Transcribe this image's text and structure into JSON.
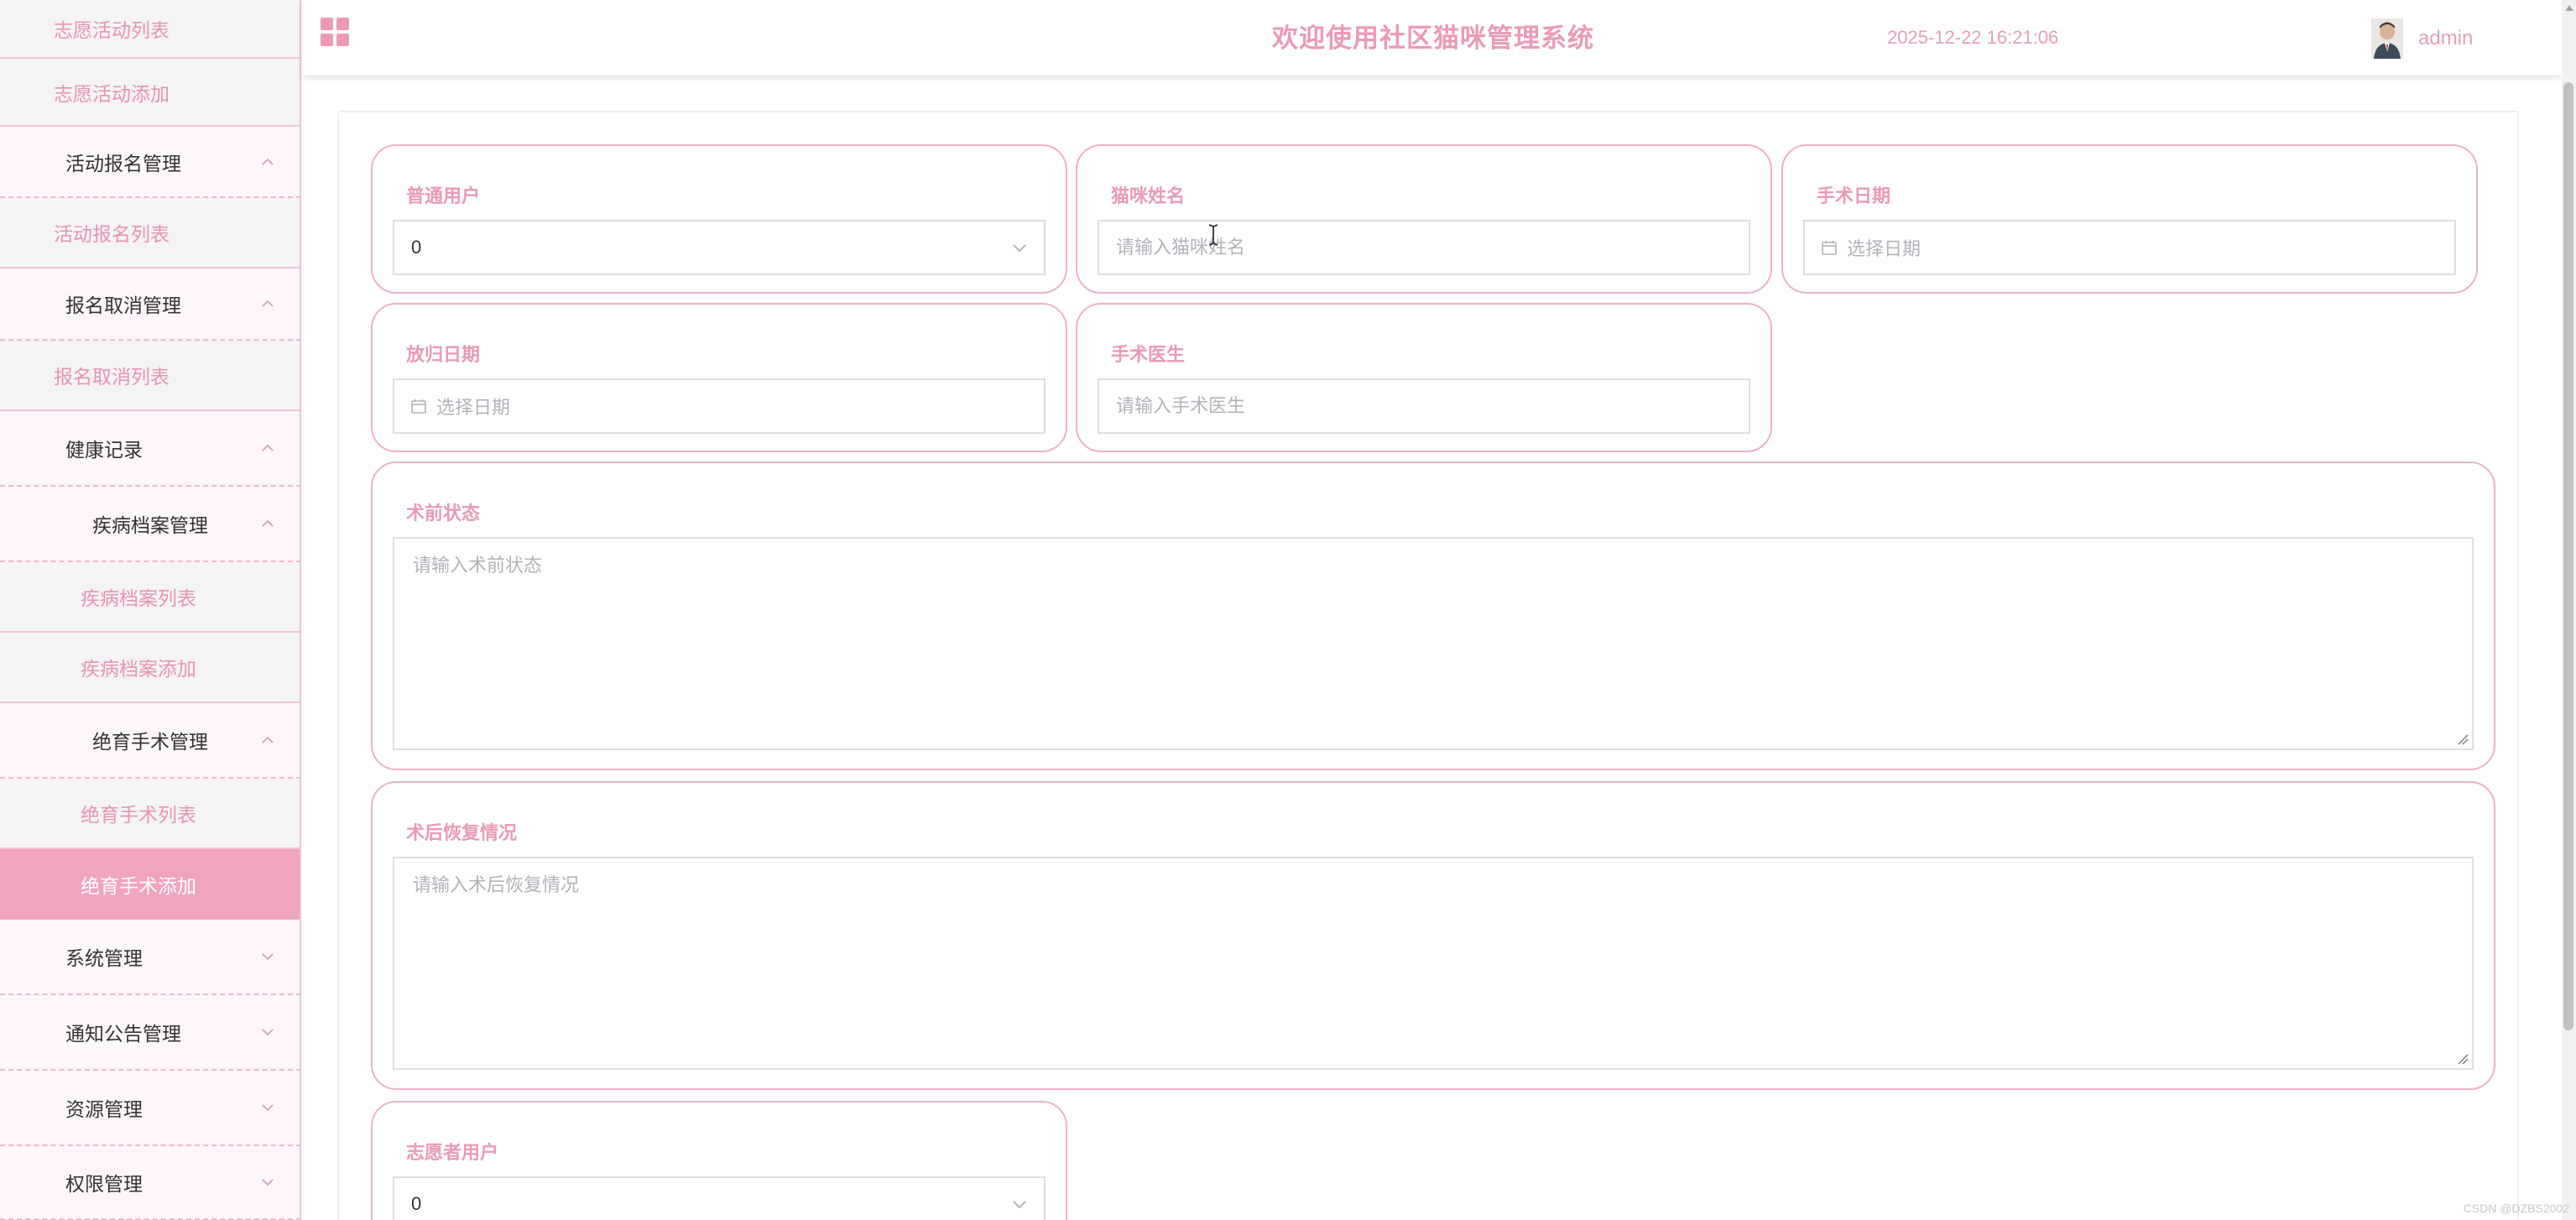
{
  "sidebar": {
    "items": [
      {
        "label": "志愿活动列表",
        "kind": "sub"
      },
      {
        "label": "志愿活动添加",
        "kind": "sub"
      },
      {
        "label": "活动报名管理",
        "kind": "menu",
        "chevron": "up"
      },
      {
        "label": "活动报名列表",
        "kind": "sub"
      },
      {
        "label": "报名取消管理",
        "kind": "menu",
        "chevron": "up"
      },
      {
        "label": "报名取消列表",
        "kind": "sub"
      },
      {
        "label": "健康记录",
        "kind": "menu",
        "chevron": "up"
      },
      {
        "label": "疾病档案管理",
        "kind": "menu",
        "chevron": "up"
      },
      {
        "label": "疾病档案列表",
        "kind": "sub"
      },
      {
        "label": "疾病档案添加",
        "kind": "sub"
      },
      {
        "label": "绝育手术管理",
        "kind": "menu",
        "chevron": "up"
      },
      {
        "label": "绝育手术列表",
        "kind": "sub"
      },
      {
        "label": "绝育手术添加",
        "kind": "sub",
        "active": true
      },
      {
        "label": "系统管理",
        "kind": "menu",
        "chevron": "down"
      },
      {
        "label": "通知公告管理",
        "kind": "menu",
        "chevron": "down"
      },
      {
        "label": "资源管理",
        "kind": "menu",
        "chevron": "down"
      },
      {
        "label": "权限管理",
        "kind": "menu",
        "chevron": "down"
      }
    ]
  },
  "header": {
    "menu_icon": "grid-icon",
    "title": "欢迎使用社区猫咪管理系统",
    "datetime": "2025-12-22 16:21:06",
    "username": "admin"
  },
  "form": {
    "ordinary_user": {
      "label": "普通用户",
      "value": "0"
    },
    "cat_name": {
      "label": "猫咪姓名",
      "placeholder": "请输入猫咪姓名"
    },
    "surgery_date": {
      "label": "手术日期",
      "placeholder": "选择日期"
    },
    "return_date": {
      "label": "放归日期",
      "placeholder": "选择日期"
    },
    "surgeon": {
      "label": "手术医生",
      "placeholder": "请输入手术医生"
    },
    "pre_op_status": {
      "label": "术前状态",
      "placeholder": "请输入术前状态"
    },
    "post_op_recovery": {
      "label": "术后恢复情况",
      "placeholder": "请输入术后恢复情况"
    },
    "volunteer_user": {
      "label": "志愿者用户",
      "value": "0"
    }
  },
  "watermark": "CSDN @DZBS2002",
  "colors": {
    "accent": "#ec9ab4",
    "active_bg": "#f1a4bd",
    "card_border": "#edb3c6"
  }
}
